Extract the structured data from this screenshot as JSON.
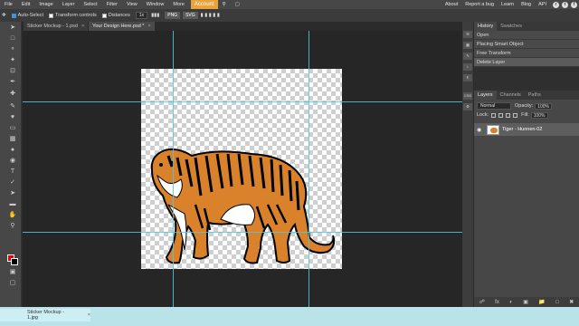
{
  "menu": [
    "File",
    "Edit",
    "Image",
    "Layer",
    "Select",
    "Filter",
    "View",
    "Window",
    "More"
  ],
  "account_label": "Account",
  "top_links": [
    "About",
    "Report a bug",
    "Learn",
    "Blog",
    "API"
  ],
  "social": [
    "r",
    "t",
    "f"
  ],
  "options": {
    "auto_select": "Auto-Select",
    "transform_controls": "Transform controls",
    "distances": "Distances",
    "zoom": "1x",
    "export_png": "PNG",
    "export_svg": "SVG"
  },
  "doc_tabs": [
    {
      "label": "Sticker Mockup - 1.psd",
      "close": "×"
    },
    {
      "label": "Your Design Here.psd *",
      "close": "×"
    }
  ],
  "history": {
    "tabs": [
      "History",
      "Swatches"
    ],
    "items": [
      "Open",
      "Placing Smart Object",
      "Free Transform",
      "Delete Layer"
    ]
  },
  "layers": {
    "tabs": [
      "Layers",
      "Channels",
      "Paths"
    ],
    "blend_mode": "Normal",
    "opacity_label": "Opacity:",
    "opacity_value": "100%",
    "lock_label": "Lock:",
    "fill_label": "Fill:",
    "fill_value": "100%",
    "layer_name": "Tiger - Hunnen-02"
  },
  "bottom_tab": {
    "label": "Sticker Mockup - 1.jpg",
    "close": "×"
  },
  "colors": {
    "accent": "#e8a33d",
    "guide": "#4ec9e0",
    "foreground": "#e00000",
    "background": "#000000",
    "tiger": "#d9822b"
  }
}
